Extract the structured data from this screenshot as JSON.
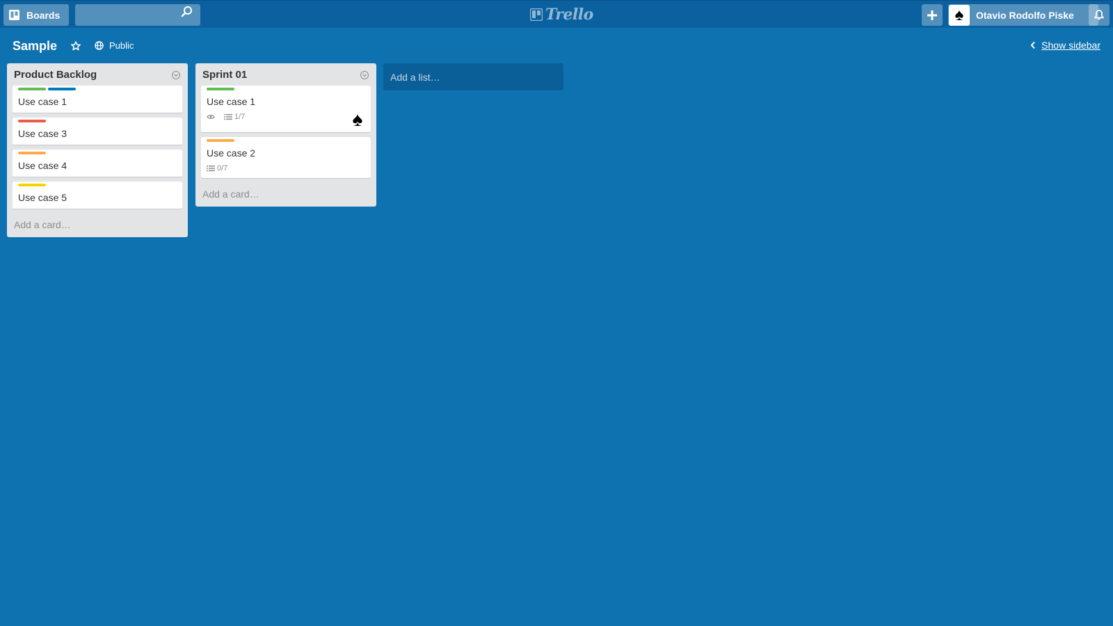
{
  "header": {
    "boards_label": "Boards",
    "search_value": "",
    "logo_text": "Trello",
    "user_name": "Otavio Rodolfo Piske",
    "user_avatar_glyph": "♠"
  },
  "board": {
    "title": "Sample",
    "visibility": "Public",
    "show_sidebar": "Show sidebar"
  },
  "lists": [
    {
      "title": "Product Backlog",
      "add_card": "Add a card…",
      "cards": [
        {
          "title": "Use case 1",
          "labels": [
            "#61bd4f",
            "#0079bf"
          ]
        },
        {
          "title": "Use case 3",
          "labels": [
            "#eb5a46"
          ]
        },
        {
          "title": "Use case 4",
          "labels": [
            "#ffab4a"
          ]
        },
        {
          "title": "Use case 5",
          "labels": [
            "#f2d600"
          ]
        }
      ]
    },
    {
      "title": "Sprint 01",
      "add_card": "Add a card…",
      "cards": [
        {
          "title": "Use case 1",
          "labels": [
            "#61bd4f"
          ],
          "watching": true,
          "checklist": "1/7",
          "member": "♠"
        },
        {
          "title": "Use case 2",
          "labels": [
            "#ffab4a"
          ],
          "checklist": "0/7"
        }
      ]
    }
  ],
  "add_list": "Add a list…",
  "colors": {
    "board_bg": "#0f72b0",
    "header_bg": "#0b61a0",
    "list_bg": "#e2e4e6"
  },
  "icons": [
    "boards-icon",
    "search-icon",
    "trello-logo-icon",
    "plus-icon",
    "bell-icon",
    "star-icon",
    "globe-icon",
    "chevron-left-icon",
    "list-menu-icon",
    "eye-icon",
    "checklist-icon"
  ]
}
